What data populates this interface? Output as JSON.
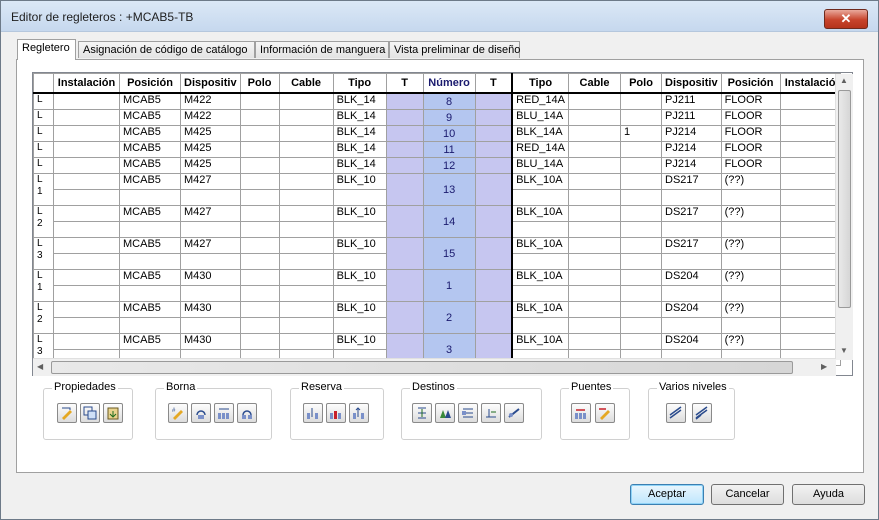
{
  "window": {
    "title": "Editor de regleteros : +MCAB5-TB",
    "close": "✕"
  },
  "tabs": [
    "Regletero",
    "Asignación de código de catálogo",
    "Información de manguera",
    "Vista preliminar de diseño"
  ],
  "grid": {
    "headers": [
      "",
      "Instalación",
      "Posición",
      "Dispositiv",
      "Polo",
      "Cable",
      "Tipo",
      "T",
      "Número",
      "T",
      "Tipo",
      "Cable",
      "Polo",
      "Dispositiv",
      "Posición",
      "Instalació"
    ],
    "rows": [
      {
        "head": "L",
        "inst": "",
        "pos": "MCAB5",
        "dev": "M422",
        "polo": "",
        "cable": "",
        "tipo": "BLK_14",
        "num": "8",
        "tipo2": "RED_14A",
        "cable2": "",
        "polo2": "",
        "dev2": "PJ211",
        "pos2": "FLOOR",
        "inst2": ""
      },
      {
        "head": "L",
        "inst": "",
        "pos": "MCAB5",
        "dev": "M422",
        "polo": "",
        "cable": "",
        "tipo": "BLK_14",
        "num": "9",
        "tipo2": "BLU_14A",
        "cable2": "",
        "polo2": "",
        "dev2": "PJ211",
        "pos2": "FLOOR",
        "inst2": ""
      },
      {
        "head": "L",
        "inst": "",
        "pos": "MCAB5",
        "dev": "M425",
        "polo": "",
        "cable": "",
        "tipo": "BLK_14",
        "num": "10",
        "tipo2": "BLK_14A",
        "cable2": "",
        "polo2": "1",
        "dev2": "PJ214",
        "pos2": "FLOOR",
        "inst2": ""
      },
      {
        "head": "L",
        "inst": "",
        "pos": "MCAB5",
        "dev": "M425",
        "polo": "",
        "cable": "",
        "tipo": "BLK_14",
        "num": "11",
        "tipo2": "RED_14A",
        "cable2": "",
        "polo2": "",
        "dev2": "PJ214",
        "pos2": "FLOOR",
        "inst2": ""
      },
      {
        "head": "L",
        "inst": "",
        "pos": "MCAB5",
        "dev": "M425",
        "polo": "",
        "cable": "",
        "tipo": "BLK_14",
        "num": "12",
        "tipo2": "BLU_14A",
        "cable2": "",
        "polo2": "",
        "dev2": "PJ214",
        "pos2": "FLOOR",
        "inst2": ""
      }
    ],
    "multi": [
      {
        "head": "L\n1",
        "pos": "MCAB5",
        "dev": "M427",
        "tipo": "BLK_10",
        "num": "13",
        "tipo2": "BLK_10A",
        "dev2": "DS217",
        "pos2": "(??)"
      },
      {
        "head": "L\n2",
        "pos": "MCAB5",
        "dev": "M427",
        "tipo": "BLK_10",
        "num": "14",
        "tipo2": "BLK_10A",
        "dev2": "DS217",
        "pos2": "(??)"
      },
      {
        "head": "L\n3",
        "pos": "MCAB5",
        "dev": "M427",
        "tipo": "BLK_10",
        "num": "15",
        "tipo2": "BLK_10A",
        "dev2": "DS217",
        "pos2": "(??)"
      },
      {
        "head": "L\n1",
        "pos": "MCAB5",
        "dev": "M430",
        "tipo": "BLK_10",
        "num": "1",
        "tipo2": "BLK_10A",
        "dev2": "DS204",
        "pos2": "(??)"
      },
      {
        "head": "L\n2",
        "pos": "MCAB5",
        "dev": "M430",
        "tipo": "BLK_10",
        "num": "2",
        "tipo2": "BLK_10A",
        "dev2": "DS204",
        "pos2": "(??)"
      },
      {
        "head": "L\n3",
        "pos": "MCAB5",
        "dev": "M430",
        "tipo": "BLK_10",
        "num": "3",
        "tipo2": "BLK_10A",
        "dev2": "DS204",
        "pos2": "(??)"
      }
    ]
  },
  "groups": {
    "propiedades": "Propiedades",
    "borna": "Borna",
    "reserva": "Reserva",
    "destinos": "Destinos",
    "puentes": "Puentes",
    "varios": "Varios niveles"
  },
  "buttons": {
    "ok": "Aceptar",
    "cancel": "Cancelar",
    "help": "Ayuda"
  },
  "colors": {
    "t_column": "#c6c6f0",
    "numero_column": "#b4c6f0",
    "default_button": "#3c7fb1"
  }
}
